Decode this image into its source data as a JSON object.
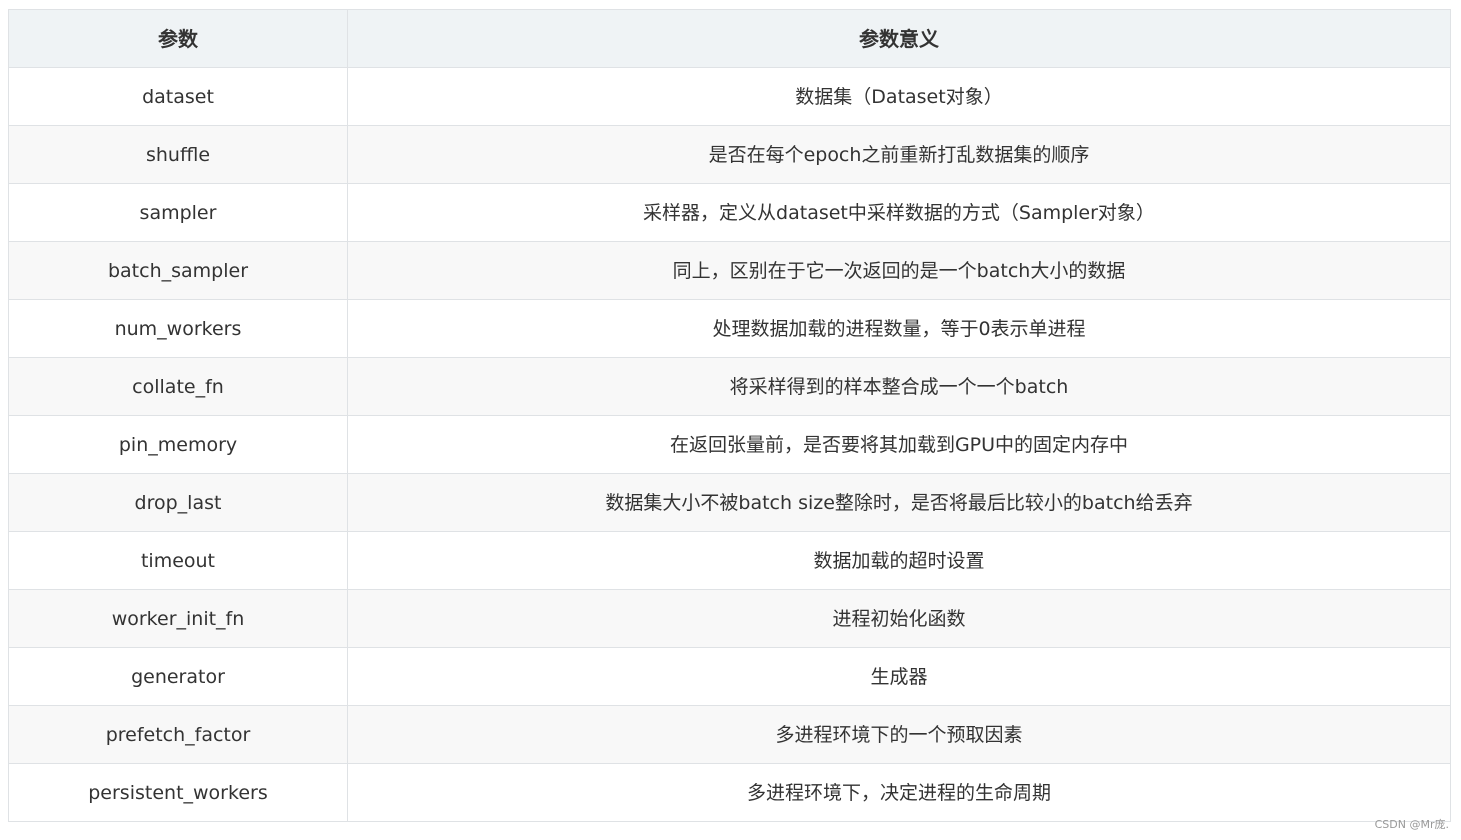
{
  "table": {
    "headers": [
      "参数",
      "参数意义"
    ],
    "rows": [
      [
        "dataset",
        "数据集（Dataset对象）"
      ],
      [
        "shuffle",
        "是否在每个epoch之前重新打乱数据集的顺序"
      ],
      [
        "sampler",
        "采样器，定义从dataset中采样数据的方式（Sampler对象）"
      ],
      [
        "batch_sampler",
        "同上，区别在于它一次返回的是一个batch大小的数据"
      ],
      [
        "num_workers",
        "处理数据加载的进程数量，等于0表示单进程"
      ],
      [
        "collate_fn",
        "将采样得到的样本整合成一个一个batch"
      ],
      [
        "pin_memory",
        "在返回张量前，是否要将其加载到GPU中的固定内存中"
      ],
      [
        "drop_last",
        "数据集大小不被batch size整除时，是否将最后比较小的batch给丢弃"
      ],
      [
        "timeout",
        "数据加载的超时设置"
      ],
      [
        "worker_init_fn",
        "进程初始化函数"
      ],
      [
        "generator",
        "生成器"
      ],
      [
        "prefetch_factor",
        "多进程环境下的一个预取因素"
      ],
      [
        "persistent_workers",
        "多进程环境下，决定进程的生命周期"
      ]
    ]
  },
  "watermark": "CSDN @Mr庞."
}
